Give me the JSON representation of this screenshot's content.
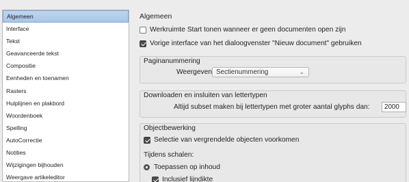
{
  "sidebar": {
    "items": [
      {
        "label": "Algemeen",
        "selected": true
      },
      {
        "label": "Interface"
      },
      {
        "label": "Tekst"
      },
      {
        "label": "Geavanceerde tekst"
      },
      {
        "label": "Compositie"
      },
      {
        "label": "Eenheden en toenamen"
      },
      {
        "label": "Rasters"
      },
      {
        "label": "Hulplijnen en plakbord"
      },
      {
        "label": "Woordenboek"
      },
      {
        "label": "Spelling"
      },
      {
        "label": "AutoCorrectie"
      },
      {
        "label": "Notities"
      },
      {
        "label": "Wijzigingen bijhouden"
      },
      {
        "label": "Weergave artikeleditor"
      }
    ]
  },
  "main": {
    "heading": "Algemeen",
    "options": {
      "start_workspace": {
        "label": "Werkruimte Start tonen wanneer er geen documenten open zijn",
        "checked": false
      },
      "legacy_new_doc": {
        "label": "Vorige interface van het dialoogvenster \"Nieuw document\" gebruiken",
        "checked": true
      }
    },
    "pagination": {
      "title": "Paginanummering",
      "view_label": "Weergeven:",
      "view_value": "Sectienummering"
    },
    "fonts": {
      "title": "Downloaden en insluiten van lettertypen",
      "subset_label": "Altijd subset maken bij lettertypen met groter aantal glyphs dan:",
      "subset_value": "2000"
    },
    "objects": {
      "title": "Objectbewerking",
      "prevent_locked": {
        "label": "Selectie van vergrendelde objecten voorkomen",
        "checked": true
      },
      "scaling_label": "Tijdens schalen:",
      "apply_content": "Toepassen op inhoud",
      "include_stroke": "Inclusief lijndikte"
    }
  }
}
